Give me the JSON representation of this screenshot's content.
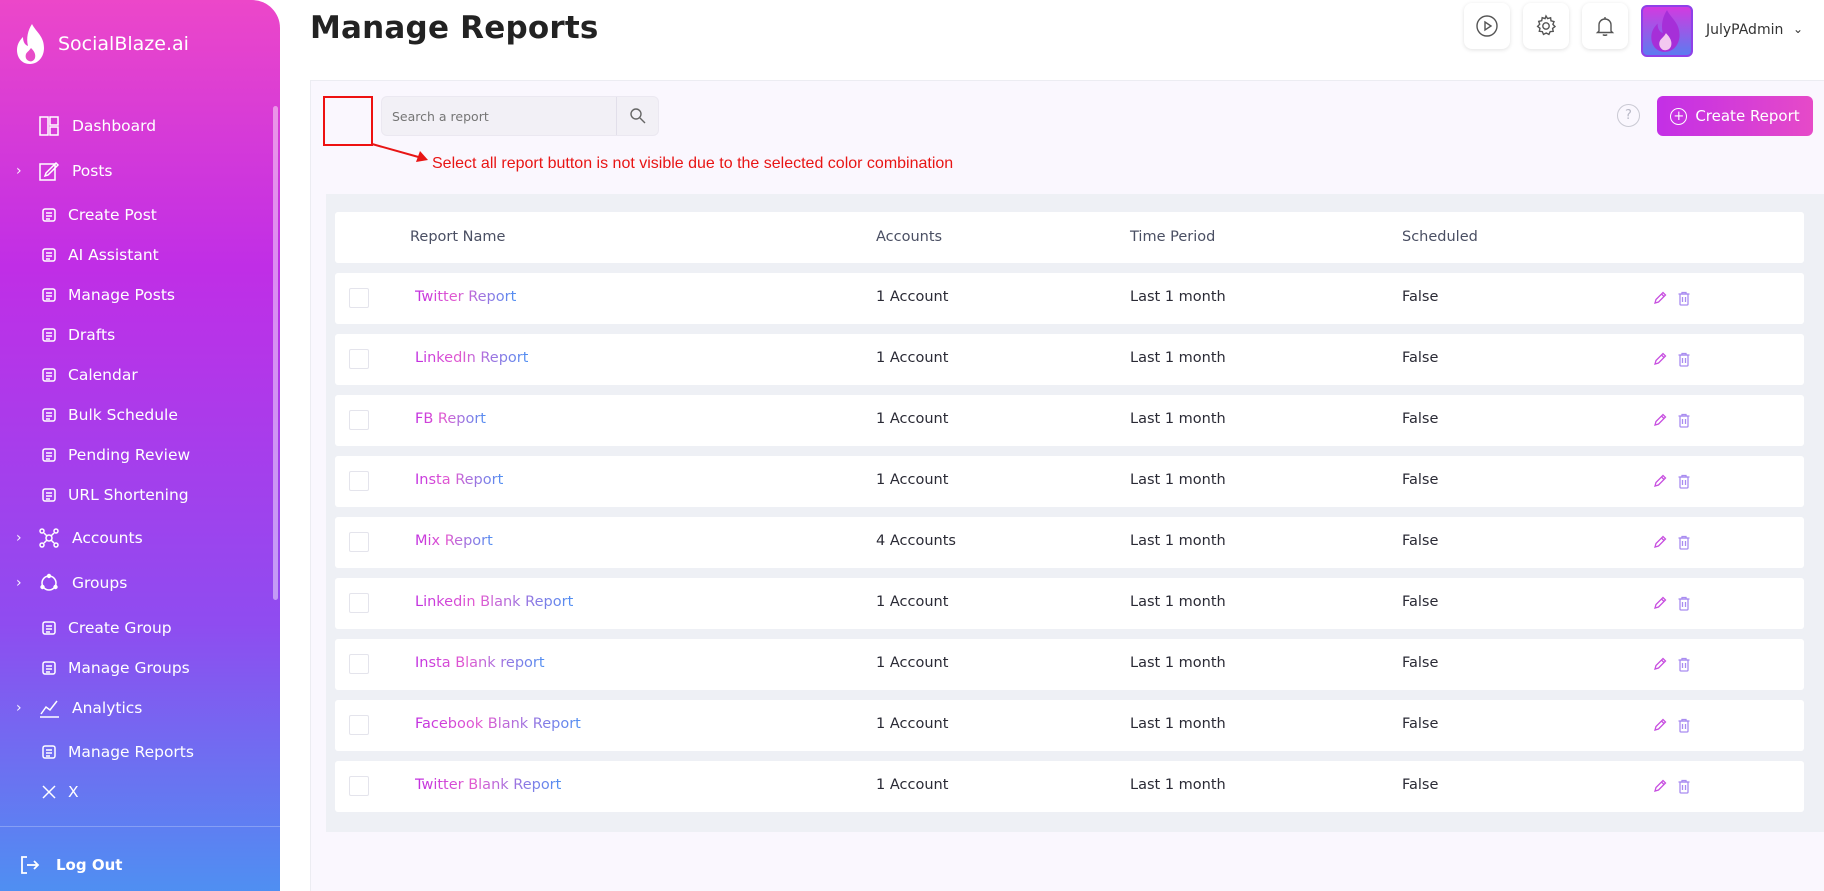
{
  "app": {
    "brand_name": "SocialBlaze.ai"
  },
  "sidebar": {
    "items": [
      {
        "label": "Dashboard",
        "icon": "dashboard-icon",
        "level": "top",
        "expandable": false
      },
      {
        "label": "Posts",
        "icon": "edit-square-icon",
        "level": "top",
        "expandable": true
      },
      {
        "label": "Create Post",
        "icon": "create-post-icon",
        "level": "sub",
        "expandable": false
      },
      {
        "label": "AI Assistant",
        "icon": "ai-assistant-icon",
        "level": "sub",
        "expandable": false
      },
      {
        "label": "Manage Posts",
        "icon": "manage-posts-icon",
        "level": "sub",
        "expandable": false
      },
      {
        "label": "Drafts",
        "icon": "drafts-icon",
        "level": "sub",
        "expandable": false
      },
      {
        "label": "Calendar",
        "icon": "calendar-icon",
        "level": "sub",
        "expandable": false
      },
      {
        "label": "Bulk Schedule",
        "icon": "bulk-schedule-icon",
        "level": "sub",
        "expandable": false
      },
      {
        "label": "Pending Review",
        "icon": "pending-review-icon",
        "level": "sub",
        "expandable": false
      },
      {
        "label": "URL Shortening",
        "icon": "url-shortening-icon",
        "level": "sub",
        "expandable": false
      },
      {
        "label": "Accounts",
        "icon": "accounts-network-icon",
        "level": "top",
        "expandable": true
      },
      {
        "label": "Groups",
        "icon": "groups-icon",
        "level": "top",
        "expandable": true
      },
      {
        "label": "Create Group",
        "icon": "create-group-icon",
        "level": "sub",
        "expandable": false
      },
      {
        "label": "Manage Groups",
        "icon": "manage-groups-icon",
        "level": "sub",
        "expandable": false
      },
      {
        "label": "Analytics",
        "icon": "analytics-chart-icon",
        "level": "top",
        "expandable": true
      },
      {
        "label": "Manage Reports",
        "icon": "manage-reports-icon",
        "level": "sub",
        "expandable": false
      },
      {
        "label": "X",
        "icon": "x-logo-icon",
        "level": "sub",
        "expandable": false
      }
    ],
    "logout_label": "Log Out"
  },
  "header": {
    "title": "Manage Reports",
    "icons": [
      "play-icon",
      "settings-icon",
      "bell-icon"
    ],
    "user_name": "JulyPAdmin"
  },
  "toolbar": {
    "search_placeholder": "Search a report",
    "create_label": "Create Report",
    "help_glyph": "?"
  },
  "annotation": {
    "text": "Select all report button is not visible due to the selected color combination",
    "color": "#e81515"
  },
  "table": {
    "columns": [
      "Report Name",
      "Accounts",
      "Time Period",
      "Scheduled"
    ],
    "rows": [
      {
        "name": "Twitter Report",
        "accounts": "1 Account",
        "period": "Last 1 month",
        "scheduled": "False"
      },
      {
        "name": "LinkedIn Report",
        "accounts": "1 Account",
        "period": "Last 1 month",
        "scheduled": "False"
      },
      {
        "name": "FB Report",
        "accounts": "1 Account",
        "period": "Last 1 month",
        "scheduled": "False"
      },
      {
        "name": "Insta Report",
        "accounts": "1 Account",
        "period": "Last 1 month",
        "scheduled": "False"
      },
      {
        "name": "Mix Report",
        "accounts": "4 Accounts",
        "period": "Last 1 month",
        "scheduled": "False"
      },
      {
        "name": "Linkedin Blank Report",
        "accounts": "1 Account",
        "period": "Last 1 month",
        "scheduled": "False"
      },
      {
        "name": "Insta Blank report",
        "accounts": "1 Account",
        "period": "Last 1 month",
        "scheduled": "False"
      },
      {
        "name": "Facebook Blank Report",
        "accounts": "1 Account",
        "period": "Last 1 month",
        "scheduled": "False"
      },
      {
        "name": "Twitter Blank Report",
        "accounts": "1 Account",
        "period": "Last 1 month",
        "scheduled": "False"
      }
    ]
  },
  "colors": {
    "brand_pink": "#ec47c9",
    "brand_purple": "#c02ee6",
    "brand_blue": "#4f8ff2",
    "annotation_red": "#e81515"
  }
}
